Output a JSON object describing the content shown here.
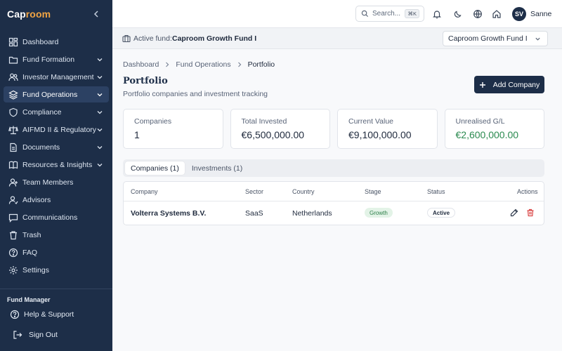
{
  "app": {
    "brand_prefix": "Cap",
    "brand_suffix": "room"
  },
  "sidebar": {
    "items": [
      {
        "label": "Dashboard",
        "icon": "dashboard-icon"
      },
      {
        "label": "Fund Formation",
        "icon": "folder-icon",
        "expandable": true
      },
      {
        "label": "Investor Management",
        "icon": "users-icon",
        "expandable": true
      },
      {
        "label": "Fund Operations",
        "icon": "layers-icon",
        "expandable": true,
        "active": true
      },
      {
        "label": "Compliance",
        "icon": "shield-icon",
        "expandable": true
      },
      {
        "label": "AIFMD II & Regulatory",
        "icon": "scale-icon",
        "expandable": true
      },
      {
        "label": "Documents",
        "icon": "document-icon",
        "expandable": true
      },
      {
        "label": "Resources & Insights",
        "icon": "book-icon",
        "expandable": true
      },
      {
        "label": "Team Members",
        "icon": "team-icon"
      },
      {
        "label": "Advisors",
        "icon": "advisor-icon"
      },
      {
        "label": "Communications",
        "icon": "message-icon"
      },
      {
        "label": "Trash",
        "icon": "trash-icon"
      },
      {
        "label": "FAQ",
        "icon": "help-circle-icon"
      },
      {
        "label": "Settings",
        "icon": "gear-icon"
      }
    ],
    "role_label": "Fund Manager",
    "help_label": "Help & Support",
    "signout_label": "Sign Out"
  },
  "topbar": {
    "search_placeholder": "Search...",
    "search_shortcut": "⌘K",
    "avatar_initials": "SV",
    "username": "Sanne"
  },
  "fundbar": {
    "label": "Active fund:",
    "fund_name": "Caproom Growth Fund I",
    "selected_fund": "Caproom Growth Fund I"
  },
  "breadcrumb": [
    "Dashboard",
    "Fund Operations",
    "Portfolio"
  ],
  "page": {
    "title": "Portfolio",
    "subtitle": "Portfolio companies and investment tracking",
    "add_button": "Add Company"
  },
  "stats": [
    {
      "label": "Companies",
      "value": "1"
    },
    {
      "label": "Total Invested",
      "value": "€6,500,000.00"
    },
    {
      "label": "Current Value",
      "value": "€9,100,000.00"
    },
    {
      "label": "Unrealised G/L",
      "value": "€2,600,000.00",
      "color": "#2a8a4f"
    }
  ],
  "tabs": [
    {
      "label": "Companies (1)",
      "active": true
    },
    {
      "label": "Investments (1)",
      "active": false
    }
  ],
  "table": {
    "headers": [
      "Company",
      "Sector",
      "Country",
      "Stage",
      "Status",
      "Actions"
    ],
    "rows": [
      {
        "company": "Volterra Systems B.V.",
        "sector": "SaaS",
        "country": "Netherlands",
        "stage": "Growth",
        "status": "Active"
      }
    ]
  }
}
